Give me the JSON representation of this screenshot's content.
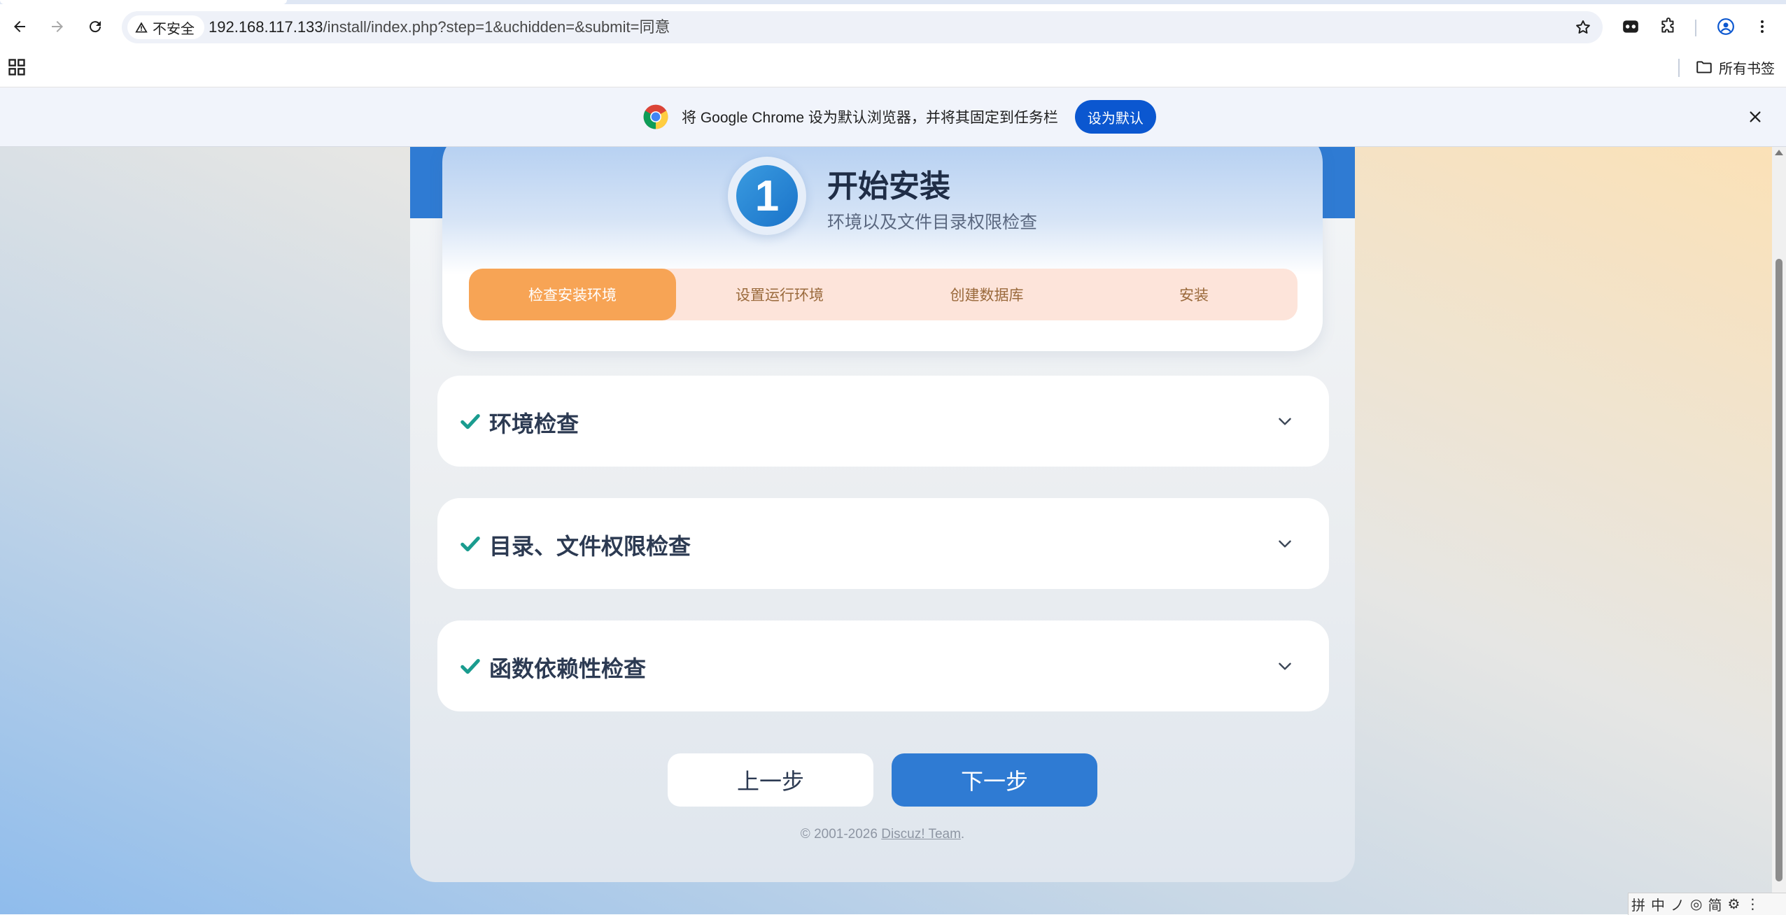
{
  "browser": {
    "security_label": "不安全",
    "url_host": "192.168.117.133",
    "url_path": "/install/index.php?step=1&uchidden=&submit=同意",
    "all_bookmarks_label": "所有书签"
  },
  "infobar": {
    "message": "将 Google Chrome 设为默认浏览器，并将其固定到任务栏",
    "button_label": "设为默认"
  },
  "header": {
    "step_number": "1",
    "title": "开始安装",
    "subtitle": "环境以及文件目录权限检查"
  },
  "progress": {
    "steps": [
      {
        "label": "检查安装环境",
        "active": true
      },
      {
        "label": "设置运行环境",
        "active": false
      },
      {
        "label": "创建数据库",
        "active": false
      },
      {
        "label": "安装",
        "active": false
      }
    ]
  },
  "sections": [
    {
      "title": "环境检查"
    },
    {
      "title": "目录、文件权限检查"
    },
    {
      "title": "函数依赖性检查"
    }
  ],
  "buttons": {
    "prev_label": "上一步",
    "next_label": "下一步"
  },
  "footer": {
    "copyright": "© 2001-2026 ",
    "team_link": "Discuz! Team",
    "period": "."
  },
  "ime": {
    "items": [
      "拼",
      "中",
      "ノ",
      "◎",
      "简",
      "⚙",
      "⋮"
    ]
  },
  "colors": {
    "accent_blue": "#2f7bd3",
    "progress_active": "#f7a455",
    "progress_inactive": "#fde4da",
    "check_color": "#1a9c8f",
    "chrome_button": "#0b57d0"
  }
}
